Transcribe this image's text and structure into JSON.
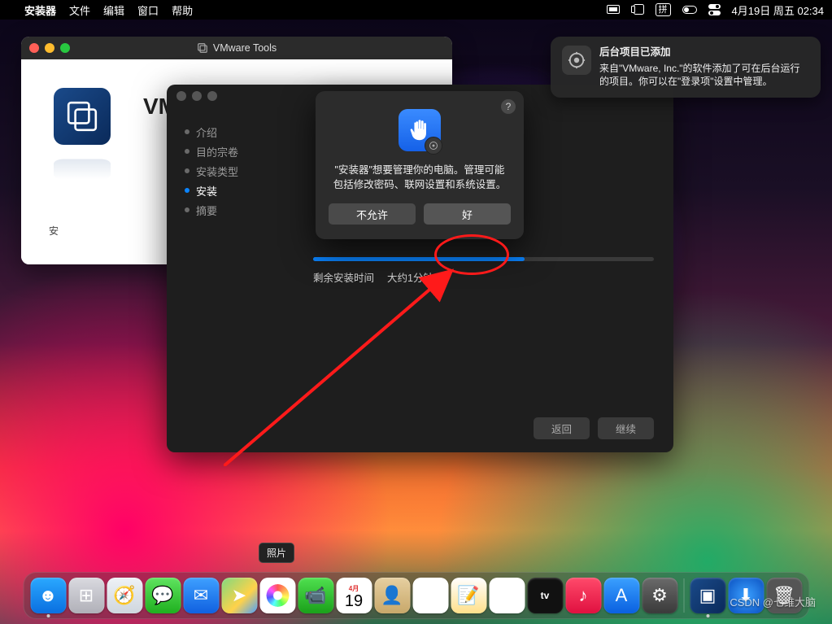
{
  "menubar": {
    "app_name": "安装器",
    "menus": [
      "文件",
      "编辑",
      "窗口",
      "帮助"
    ],
    "input_method": "拼",
    "datetime": "4月19日 周五  02:34"
  },
  "vmware_window": {
    "title": "VMware Tools",
    "heading": "VM...",
    "caption": "安"
  },
  "installer": {
    "steps": [
      "介绍",
      "目的宗卷",
      "安装类型",
      "安装",
      "摘要"
    ],
    "active_step_index": 3,
    "progress_percent": 62,
    "progress_label": "剩余安装时间",
    "progress_value": "大约1分钟",
    "back": "返回",
    "continue": "继续"
  },
  "dialog": {
    "message": "\"安装器\"想要管理你的电脑。管理可能包括修改密码、联网设置和系统设置。",
    "deny": "不允许",
    "allow": "好",
    "help": "?"
  },
  "notification": {
    "title": "后台项目已添加",
    "body": "来自\"VMware, Inc.\"的软件添加了可在后台运行的项目。你可以在\"登录项\"设置中管理。"
  },
  "dock": {
    "tooltip": "照片",
    "calendar_month": "4月",
    "calendar_day": "19",
    "apps": [
      {
        "name": "finder",
        "bg": "linear-gradient(180deg,#2aa8ff,#0a6fe0)",
        "glyph": "☻"
      },
      {
        "name": "launchpad",
        "bg": "linear-gradient(180deg,#d9d9df,#b0b0b8)",
        "glyph": "⊞"
      },
      {
        "name": "safari",
        "bg": "linear-gradient(180deg,#eef2f6,#cfd6de)",
        "glyph": "🧭"
      },
      {
        "name": "messages",
        "bg": "linear-gradient(180deg,#5fe35f,#1fb01f)",
        "glyph": "💬"
      },
      {
        "name": "mail",
        "bg": "linear-gradient(180deg,#3ea0ff,#1060e0)",
        "glyph": "✉"
      },
      {
        "name": "maps",
        "bg": "linear-gradient(135deg,#7fd97f,#ffd24a 60%,#4aa0ff)",
        "glyph": "➤"
      },
      {
        "name": "photos",
        "bg": "#fff",
        "glyph": "✿"
      },
      {
        "name": "facetime",
        "bg": "linear-gradient(180deg,#4fe04f,#1aa01a)",
        "glyph": "📹"
      },
      {
        "name": "calendar",
        "bg": "#fff",
        "glyph": ""
      },
      {
        "name": "contacts",
        "bg": "linear-gradient(180deg,#e6cfa0,#c8a86a)",
        "glyph": "👤"
      },
      {
        "name": "reminders",
        "bg": "#fff",
        "glyph": "☰"
      },
      {
        "name": "notes",
        "bg": "linear-gradient(180deg,#fff,#ffe08a)",
        "glyph": "📝"
      },
      {
        "name": "freeform",
        "bg": "#fff",
        "glyph": "〰"
      },
      {
        "name": "tv",
        "bg": "#111",
        "glyph": "tv"
      },
      {
        "name": "music",
        "bg": "linear-gradient(180deg,#ff4a6a,#e01040)",
        "glyph": "♪"
      },
      {
        "name": "appstore",
        "bg": "linear-gradient(180deg,#3aa0ff,#0a60e0)",
        "glyph": "A"
      },
      {
        "name": "settings",
        "bg": "linear-gradient(180deg,#6a6a6a,#3a3a3a)",
        "glyph": "⚙"
      }
    ],
    "right": [
      {
        "name": "installer-dock",
        "bg": "linear-gradient(135deg,#1a4a8a,#0a2a5a)",
        "glyph": "▣"
      },
      {
        "name": "downloads",
        "bg": "radial-gradient(circle,#3aa0ff,#0a50c0)",
        "glyph": "⬇"
      },
      {
        "name": "trash",
        "bg": "#555",
        "glyph": "🗑"
      }
    ]
  },
  "watermark": "CSDN @七维大脑"
}
